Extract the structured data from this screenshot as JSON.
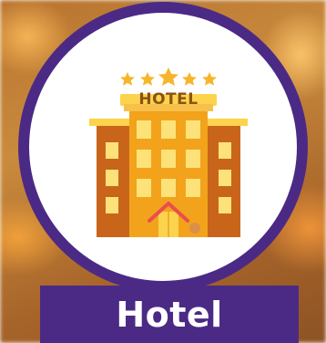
{
  "icon": {
    "name": "hotel-icon",
    "sign_text": "HOTEL",
    "stars": 5
  },
  "label": "Hotel",
  "colors": {
    "accent": "#4b2a86",
    "ring": "#4b2a86",
    "building_main": "#f2a31b",
    "building_side": "#c9651b",
    "window": "#fde27a",
    "door_roof": "#e94e4e",
    "star": "#f7b52b"
  }
}
